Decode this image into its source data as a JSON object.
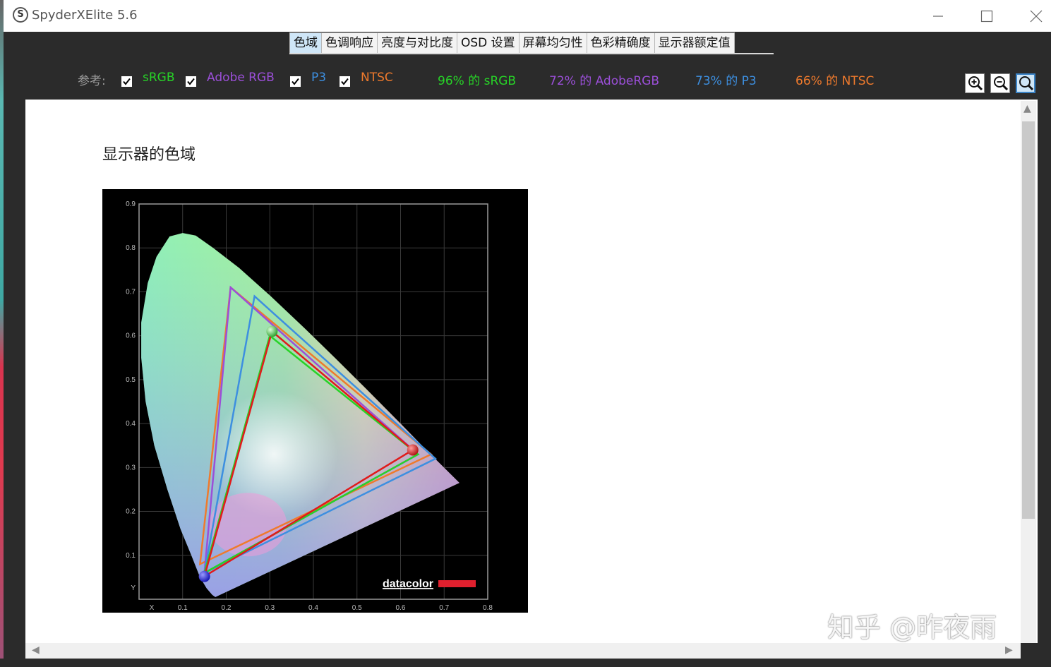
{
  "window": {
    "title": "SpyderXElite 5.6",
    "icon": "S"
  },
  "tabs": [
    "色域",
    "色调响应",
    "亮度与对比度",
    "OSD 设置",
    "屏幕均匀性",
    "色彩精确度",
    "显示器额定值"
  ],
  "reference": {
    "label": "参考:",
    "items": [
      {
        "name": "sRGB",
        "checked": true,
        "color": "#27d327"
      },
      {
        "name": "Adobe RGB",
        "checked": true,
        "color": "#9b4fd8"
      },
      {
        "name": "P3",
        "checked": true,
        "color": "#3d8fe0"
      },
      {
        "name": "NTSC",
        "checked": true,
        "color": "#ef7a2c"
      }
    ],
    "results": [
      {
        "text": "96% 的 sRGB",
        "color": "#27d327"
      },
      {
        "text": "72% 的 AdobeRGB",
        "color": "#9b4fd8"
      },
      {
        "text": "73% 的 P3",
        "color": "#3d8fe0"
      },
      {
        "text": "66% 的 NTSC",
        "color": "#ef7a2c"
      }
    ]
  },
  "zoom_buttons": [
    "zoom-in-icon",
    "zoom-out-icon",
    "zoom-fit-icon"
  ],
  "section_title": "显示器的色域",
  "chart_data": {
    "type": "scatter",
    "xlabel": "X",
    "ylabel": "Y",
    "xlim": [
      0.0,
      0.8
    ],
    "ylim": [
      0.0,
      0.9
    ],
    "x_ticks": [
      "0.1",
      "0.2",
      "0.3",
      "0.4",
      "0.5",
      "0.6",
      "0.7",
      "0.8"
    ],
    "y_ticks": [
      "0.1",
      "0.2",
      "0.3",
      "0.4",
      "0.5",
      "0.6",
      "0.7",
      "0.8",
      "0.9"
    ],
    "logo": "datacolor",
    "spectral_locus": [
      [
        0.175,
        0.005
      ],
      [
        0.168,
        0.01
      ],
      [
        0.155,
        0.025
      ],
      [
        0.14,
        0.05
      ],
      [
        0.12,
        0.1
      ],
      [
        0.095,
        0.16
      ],
      [
        0.065,
        0.25
      ],
      [
        0.035,
        0.35
      ],
      [
        0.015,
        0.45
      ],
      [
        0.005,
        0.55
      ],
      [
        0.005,
        0.63
      ],
      [
        0.02,
        0.72
      ],
      [
        0.04,
        0.78
      ],
      [
        0.07,
        0.826
      ],
      [
        0.1,
        0.834
      ],
      [
        0.13,
        0.828
      ],
      [
        0.17,
        0.8
      ],
      [
        0.23,
        0.754
      ],
      [
        0.3,
        0.692
      ],
      [
        0.38,
        0.617
      ],
      [
        0.45,
        0.549
      ],
      [
        0.52,
        0.48
      ],
      [
        0.6,
        0.4
      ],
      [
        0.66,
        0.339
      ],
      [
        0.735,
        0.265
      ]
    ],
    "gamuts": [
      {
        "name": "NTSC",
        "color": "#ef7a2c",
        "points": [
          [
            0.67,
            0.33
          ],
          [
            0.21,
            0.71
          ],
          [
            0.14,
            0.08
          ]
        ]
      },
      {
        "name": "Adobe RGB",
        "color": "#9b4fd8",
        "points": [
          [
            0.64,
            0.33
          ],
          [
            0.21,
            0.71
          ],
          [
            0.15,
            0.06
          ]
        ]
      },
      {
        "name": "P3",
        "color": "#3d8fe0",
        "points": [
          [
            0.68,
            0.32
          ],
          [
            0.265,
            0.69
          ],
          [
            0.15,
            0.06
          ]
        ]
      },
      {
        "name": "sRGB",
        "color": "#27d327",
        "points": [
          [
            0.64,
            0.33
          ],
          [
            0.3,
            0.6
          ],
          [
            0.15,
            0.06
          ]
        ]
      }
    ],
    "measured": {
      "color": "#e01b1b",
      "points": [
        [
          0.628,
          0.34
        ],
        [
          0.305,
          0.61
        ],
        [
          0.15,
          0.052
        ]
      ]
    }
  },
  "watermark": "知乎 @昨夜雨"
}
